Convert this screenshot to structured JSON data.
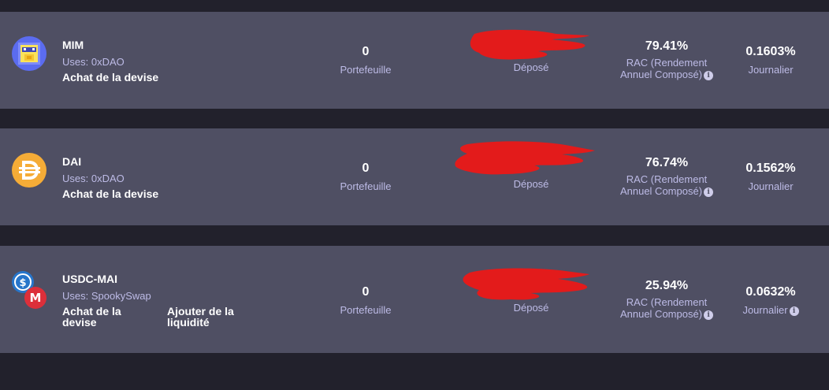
{
  "rows": [
    {
      "name": "MIM",
      "uses": "Uses: 0xDAO",
      "action": "Achat de la devise",
      "portefeuille_value": "0",
      "portefeuille_label": "Portefeuille",
      "depose_label": "Déposé",
      "rac_value": "79.41%",
      "rac_label_1": "RAC (Rendement",
      "rac_label_2": "Annuel Composé)",
      "daily_value": "0.1603%",
      "daily_label": "Journalier",
      "icon": "mim-icon"
    },
    {
      "name": "DAI",
      "uses": "Uses: 0xDAO",
      "action": "Achat de la devise",
      "portefeuille_value": "0",
      "portefeuille_label": "Portefeuille",
      "depose_label": "Déposé",
      "rac_value": "76.74%",
      "rac_label_1": "RAC (Rendement",
      "rac_label_2": "Annuel Composé)",
      "daily_value": "0.1562%",
      "daily_label": "Journalier",
      "icon": "dai-icon"
    },
    {
      "name": "USDC-MAI",
      "uses": "Uses: SpookySwap",
      "action": "Achat de la devise",
      "action_2": "Ajouter de la liquidité",
      "portefeuille_value": "0",
      "portefeuille_label": "Portefeuille",
      "depose_label": "Déposé",
      "rac_value": "25.94%",
      "rac_label_1": "RAC (Rendement",
      "rac_label_2": "Annuel Composé)",
      "daily_value": "0.0632%",
      "daily_label": "Journalier",
      "icon": "usdc-mai-icon"
    }
  ],
  "colors": {
    "background": "#22212c",
    "row": "#4f4f63",
    "label": "#bdbbe6",
    "redaction": "#e31b1b"
  }
}
